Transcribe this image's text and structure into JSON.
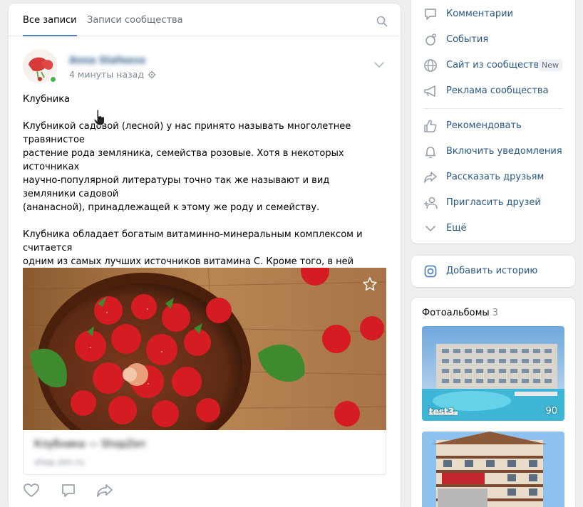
{
  "tabs": {
    "all": "Все записи",
    "community": "Записи сообщества"
  },
  "post": {
    "author": "Anna Stafeeva",
    "time": "4 минуты назад",
    "title": "Клубника",
    "paragraph1": "Клубникой садовой (лесной) у нас принято называть многолетнее травянистое\nрастение рода земляника, семейства розовые. Хотя в некоторых источниках\nнаучно-популярной литературы точно так же называют и вид земляники садовой\n(ананасной), принадлежащей к этому же роду и семейству.",
    "paragraph2": "Клубника обладает богатым витаминно-минеральным комплексом и считается\nодним из самых лучших источников витамина С. Кроме того, в ней содержится\nнабор биологически активных веществ, которые, по мнению учёных, вносят\nбольшой вклад в систему защиты организма и снижают риск развития\nвоспалений различной природы.",
    "link_title": "Клубника — ShopZen",
    "link_domain": "shop.zen.ru"
  },
  "menu": {
    "comments": "Комментарии",
    "events": "События",
    "site": "Сайт из сообщества",
    "new_badge": "New",
    "ads": "Реклама сообщества",
    "recommend": "Рекомендовать",
    "notify": "Включить уведомления",
    "share": "Рассказать друзьям",
    "invite": "Пригласить друзей",
    "more": "Ещё"
  },
  "story": {
    "label": "Добавить историю"
  },
  "albums": {
    "title": "Фотоальбомы",
    "count": "3",
    "items": [
      {
        "name": "test3",
        "count": "90"
      },
      {
        "name": "",
        "count": ""
      }
    ]
  },
  "colors": {
    "link": "#2a5885",
    "accent": "#5181b8",
    "muted": "#818c99",
    "online": "#4bb34b"
  }
}
